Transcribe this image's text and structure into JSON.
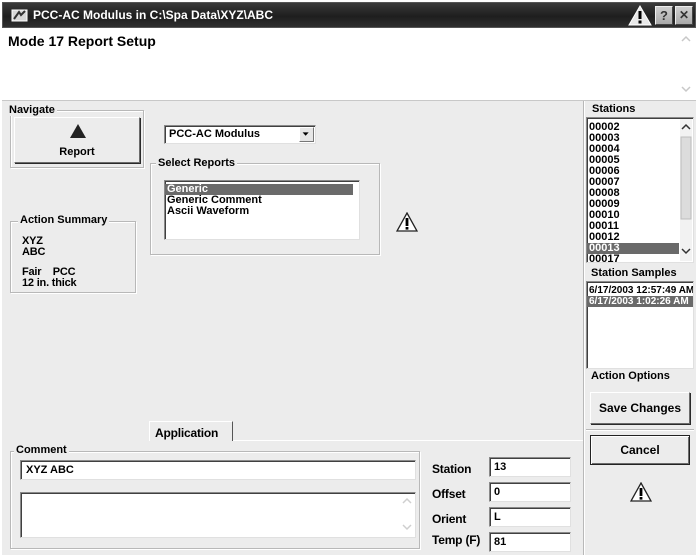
{
  "window": {
    "title": "PCC-AC Modulus in C:\\Spa Data\\XYZ\\ABC",
    "help_label": "?",
    "close_label": "✕"
  },
  "header": {
    "title": "Mode 17 Report Setup"
  },
  "navigate": {
    "legend": "Navigate",
    "report_button": "Report"
  },
  "action_summary": {
    "legend": "Action Summary",
    "line1": "XYZ",
    "line2": "ABC",
    "line3": "Fair    PCC",
    "line4": "12 in. thick"
  },
  "mode_select": {
    "value": "PCC-AC Modulus"
  },
  "select_reports": {
    "legend": "Select Reports",
    "items": [
      {
        "label": "Generic",
        "selected": true
      },
      {
        "label": "Generic Comment",
        "selected": false
      },
      {
        "label": "Ascii Waveform",
        "selected": false
      }
    ]
  },
  "tab": {
    "label": "Application"
  },
  "comment": {
    "legend": "Comment",
    "line_value": "XYZ ABC",
    "area_value": ""
  },
  "fields": {
    "station": {
      "label": "Station",
      "value": "13"
    },
    "offset": {
      "label": "Offset",
      "value": "0"
    },
    "orient": {
      "label": "Orient",
      "value": "L"
    },
    "temp": {
      "label": "Temp (F)",
      "value": "81"
    }
  },
  "stations": {
    "legend": "Stations",
    "items": [
      "00002",
      "00003",
      "00004",
      "00005",
      "00006",
      "00007",
      "00008",
      "00009",
      "00010",
      "00011",
      "00012",
      "00013",
      "00017"
    ],
    "selected": "00013"
  },
  "station_samples": {
    "legend": "Station Samples",
    "items": [
      {
        "label": "6/17/2003 12:57:49 AM",
        "selected": false
      },
      {
        "label": "6/17/2003 1:02:26 AM",
        "selected": true
      }
    ]
  },
  "action_options": {
    "legend": "Action Options",
    "save_button": "Save Changes",
    "cancel_button": "Cancel"
  },
  "colors": {
    "titlebar": "#1e1e1e",
    "panel": "#ececec",
    "selection": "#6a6a6a"
  }
}
